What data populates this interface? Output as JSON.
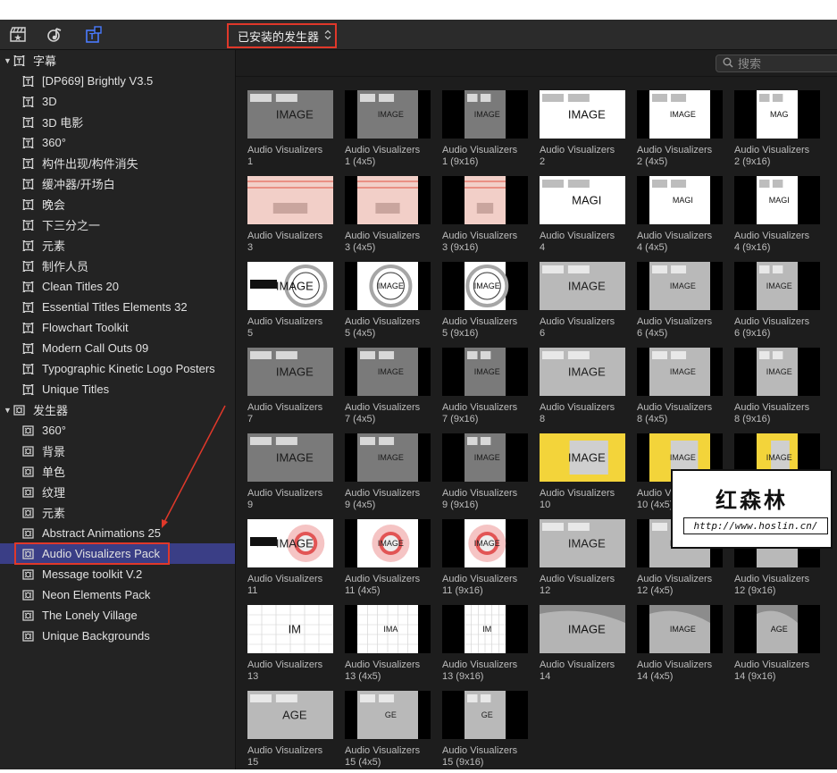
{
  "toolbar": {
    "icons": [
      "clapper-star-icon",
      "music-note-icon",
      "titles-icon"
    ],
    "dropdown_label": "已安装的发生器",
    "dropdown_chevron": "⌃⌄"
  },
  "search": {
    "placeholder": "搜索",
    "icon": "magnifier-icon"
  },
  "sidebar": {
    "titles_category": {
      "label": "字幕",
      "expanded": true
    },
    "titles_items": [
      "[DP669] Brightly V3.5",
      "3D",
      "3D 电影",
      "360°",
      "构件出现/构件消失",
      "缓冲器/开场白",
      "晚会",
      "下三分之一",
      "元素",
      "制作人员",
      "Clean Titles 20",
      "Essential Titles Elements 32",
      "Flowchart Toolkit",
      "Modern Call Outs 09",
      "Typographic Kinetic Logo Posters",
      "Unique Titles"
    ],
    "generators_category": {
      "label": "发生器",
      "expanded": true
    },
    "generators_items": [
      "360°",
      "背景",
      "单色",
      "纹理",
      "元素",
      "Abstract Animations 25",
      "Audio Visualizers Pack",
      "Message toolkit V.2",
      "Neon Elements Pack",
      "The Lonely Village",
      "Unique Backgrounds"
    ],
    "selected": "Audio Visualizers Pack"
  },
  "grid": {
    "tiles": [
      {
        "l1": "Audio Visualizers",
        "l2": "1",
        "style": "gray-wide",
        "text": "IMAGE"
      },
      {
        "l1": "Audio Visualizers",
        "l2": "1 (4x5)",
        "style": "gray-45",
        "text": "IMAGE"
      },
      {
        "l1": "Audio Visualizers",
        "l2": "1 (9x16)",
        "style": "gray-916",
        "text": "IMAGE"
      },
      {
        "l1": "Audio Visualizers",
        "l2": "2",
        "style": "white-wide",
        "text": "IMAGE"
      },
      {
        "l1": "Audio Visualizers",
        "l2": "2 (4x5)",
        "style": "white-45",
        "text": "IMAGE"
      },
      {
        "l1": "Audio Visualizers",
        "l2": "2 (9x16)",
        "style": "white-916",
        "text": "MAG"
      },
      {
        "l1": "Audio Visualizers",
        "l2": "3",
        "style": "pink-wide",
        "text": ""
      },
      {
        "l1": "Audio Visualizers",
        "l2": "3 (4x5)",
        "style": "pink-45",
        "text": ""
      },
      {
        "l1": "Audio Visualizers",
        "l2": "3 (9x16)",
        "style": "pink-916",
        "text": ""
      },
      {
        "l1": "Audio Visualizers",
        "l2": "4",
        "style": "white-wide",
        "text": "MAGI"
      },
      {
        "l1": "Audio Visualizers",
        "l2": "4 (4x5)",
        "style": "white-45",
        "text": "MAGI"
      },
      {
        "l1": "Audio Visualizers",
        "l2": "4 (9x16)",
        "style": "white-916",
        "text": "MAGI"
      },
      {
        "l1": "Audio Visualizers",
        "l2": "5",
        "style": "circle-wide",
        "text": "IMAGE"
      },
      {
        "l1": "Audio Visualizers",
        "l2": "5 (4x5)",
        "style": "circle-45",
        "text": "IMAGE"
      },
      {
        "l1": "Audio Visualizers",
        "l2": "5 (9x16)",
        "style": "circle-916",
        "text": "IMAGE"
      },
      {
        "l1": "Audio Visualizers",
        "l2": "6",
        "style": "light-wide",
        "text": "IMAGE"
      },
      {
        "l1": "Audio Visualizers",
        "l2": "6 (4x5)",
        "style": "light-45",
        "text": "IMAGE"
      },
      {
        "l1": "Audio Visualizers",
        "l2": "6 (9x16)",
        "style": "light-916",
        "text": "IMAGE"
      },
      {
        "l1": "Audio Visualizers",
        "l2": "7",
        "style": "gray-wide",
        "text": "IMAGE"
      },
      {
        "l1": "Audio Visualizers",
        "l2": "7 (4x5)",
        "style": "gray-45",
        "text": "IMAGE"
      },
      {
        "l1": "Audio Visualizers",
        "l2": "7 (9x16)",
        "style": "gray-916",
        "text": "IMAGE"
      },
      {
        "l1": "Audio Visualizers",
        "l2": "8",
        "style": "light-wide",
        "text": "IMAGE"
      },
      {
        "l1": "Audio Visualizers",
        "l2": "8 (4x5)",
        "style": "light-45",
        "text": "IMAGE"
      },
      {
        "l1": "Audio Visualizers",
        "l2": "8 (9x16)",
        "style": "light-916",
        "text": "IMAGE"
      },
      {
        "l1": "Audio Visualizers",
        "l2": "9",
        "style": "gray-wide",
        "text": "IMAGE"
      },
      {
        "l1": "Audio Visualizers",
        "l2": "9 (4x5)",
        "style": "gray-45",
        "text": "IMAGE"
      },
      {
        "l1": "Audio Visualizers",
        "l2": "9 (9x16)",
        "style": "gray-916",
        "text": "IMAGE"
      },
      {
        "l1": "Audio Visualizers",
        "l2": "10",
        "style": "yellow-wide",
        "text": "IMAGE"
      },
      {
        "l1": "Audio Visualizers",
        "l2": "10 (4x5)",
        "style": "yellow-45",
        "text": "IMAGE"
      },
      {
        "l1": "Audio Visualizers",
        "l2": "10 (9x16)",
        "style": "yellow-916",
        "text": "IMAGE"
      },
      {
        "l1": "Audio Visualizers",
        "l2": "11",
        "style": "redcircle-wide",
        "text": "IMAGE"
      },
      {
        "l1": "Audio Visualizers",
        "l2": "11 (4x5)",
        "style": "redcircle-45",
        "text": "IMAGE"
      },
      {
        "l1": "Audio Visualizers",
        "l2": "11 (9x16)",
        "style": "redcircle-916",
        "text": "IMAGE"
      },
      {
        "l1": "Audio Visualizers",
        "l2": "12",
        "style": "light-wide",
        "text": "IMAGE"
      },
      {
        "l1": "Audio Visualizers",
        "l2": "12 (4x5)",
        "style": "light-45",
        "text": "IMAGE"
      },
      {
        "l1": "Audio Visualizers",
        "l2": "12 (9x16)",
        "style": "light-916",
        "text": "IMAGE"
      },
      {
        "l1": "Audio Visualizers",
        "l2": "13",
        "style": "grid-wide",
        "text": "IM"
      },
      {
        "l1": "Audio Visualizers",
        "l2": "13 (4x5)",
        "style": "grid-45",
        "text": "IMA"
      },
      {
        "l1": "Audio Visualizers",
        "l2": "13 (9x16)",
        "style": "grid-916",
        "text": "IM"
      },
      {
        "l1": "Audio Visualizers",
        "l2": "14",
        "style": "brush-wide",
        "text": "IMAGE"
      },
      {
        "l1": "Audio Visualizers",
        "l2": "14 (4x5)",
        "style": "brush-45",
        "text": "IMAGE"
      },
      {
        "l1": "Audio Visualizers",
        "l2": "14 (9x16)",
        "style": "brush-916",
        "text": "AGE"
      },
      {
        "l1": "Audio Visualizers",
        "l2": "15",
        "style": "light-wide",
        "text": "AGE"
      },
      {
        "l1": "Audio Visualizers",
        "l2": "15 (4x5)",
        "style": "light-45",
        "text": "GE"
      },
      {
        "l1": "Audio Visualizers",
        "l2": "15 (9x16)",
        "style": "light-916",
        "text": "GE"
      }
    ]
  },
  "watermark": {
    "title": "红森林",
    "url": "http://www.hoslin.cn/"
  },
  "colors": {
    "selection": "#3a3e86",
    "annotation_red": "#e0382a",
    "panel": "#1f1f1f"
  }
}
